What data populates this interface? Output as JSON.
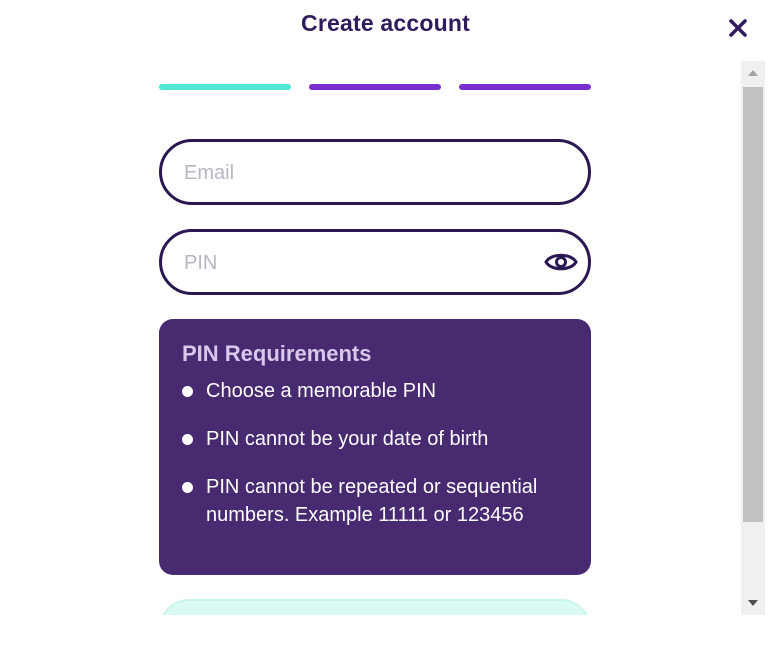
{
  "header": {
    "title": "Create account",
    "close_icon": "close-icon"
  },
  "progress": {
    "steps": [
      {
        "state": "complete",
        "color": "#4fe6d8"
      },
      {
        "state": "pending",
        "color": "#7a2fd0"
      },
      {
        "state": "pending",
        "color": "#7a2fd0"
      }
    ]
  },
  "form": {
    "email": {
      "placeholder": "Email",
      "value": ""
    },
    "pin": {
      "placeholder": "PIN",
      "value": "",
      "toggle_icon": "eye-icon"
    }
  },
  "pin_requirements": {
    "title": "PIN Requirements",
    "items": [
      "Choose a memorable PIN",
      "PIN cannot be your date of birth",
      "PIN cannot be repeated or sequential numbers. Example 11111 or 123456"
    ]
  },
  "colors": {
    "primary": "#2f1b5c",
    "panel": "#472a70",
    "accent_teal": "#4fe6d8",
    "accent_purple": "#7a2fd0",
    "cta_bg": "#d9fbf3"
  }
}
